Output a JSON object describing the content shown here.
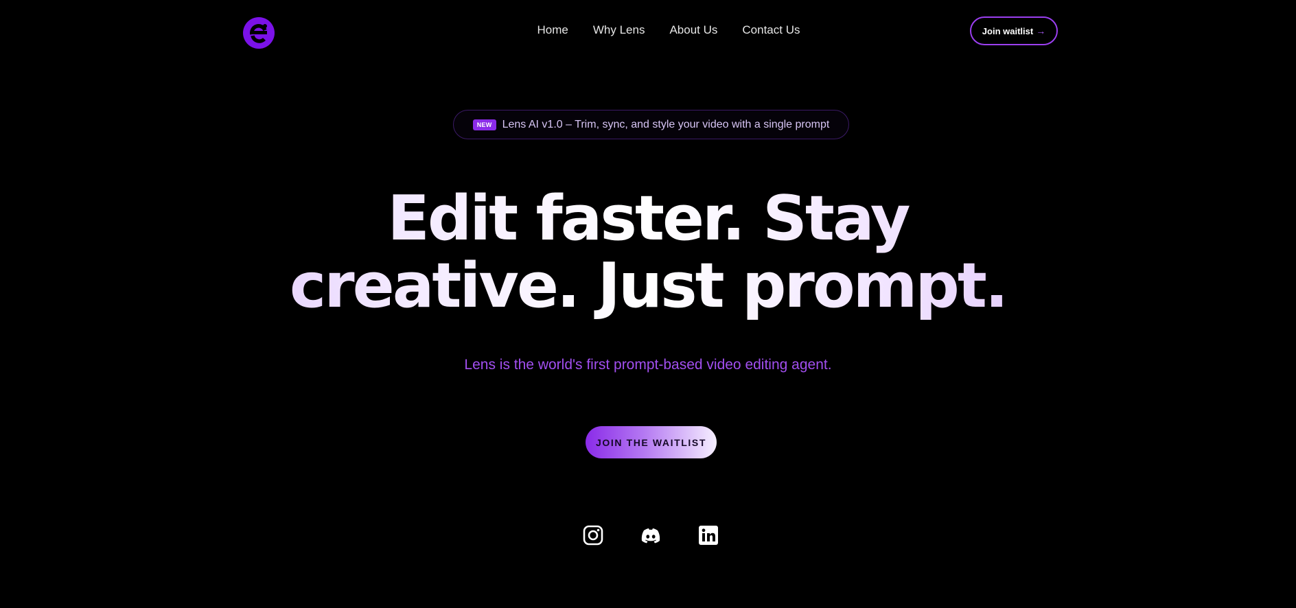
{
  "nav": {
    "links": [
      "Home",
      "Why Lens",
      "About Us",
      "Contact Us"
    ],
    "join_label": "Join waitlist",
    "join_arrow": "→"
  },
  "announcement": {
    "badge": "NEW",
    "text": "Lens AI v1.0 – Trim, sync, and style your video with a single prompt"
  },
  "hero": {
    "headline_line1": "Edit faster. Stay",
    "headline_line2": "creative. Just prompt.",
    "subtitle": "Lens is the world's first prompt-based video editing agent.",
    "cta_label": "JOIN THE WAITLIST"
  },
  "socials": [
    {
      "name": "instagram-icon"
    },
    {
      "name": "discord-icon"
    },
    {
      "name": "linkedin-icon"
    }
  ],
  "colors": {
    "background": "#000000",
    "accent": "#8b2be8",
    "subtitle": "#a24ff0"
  }
}
